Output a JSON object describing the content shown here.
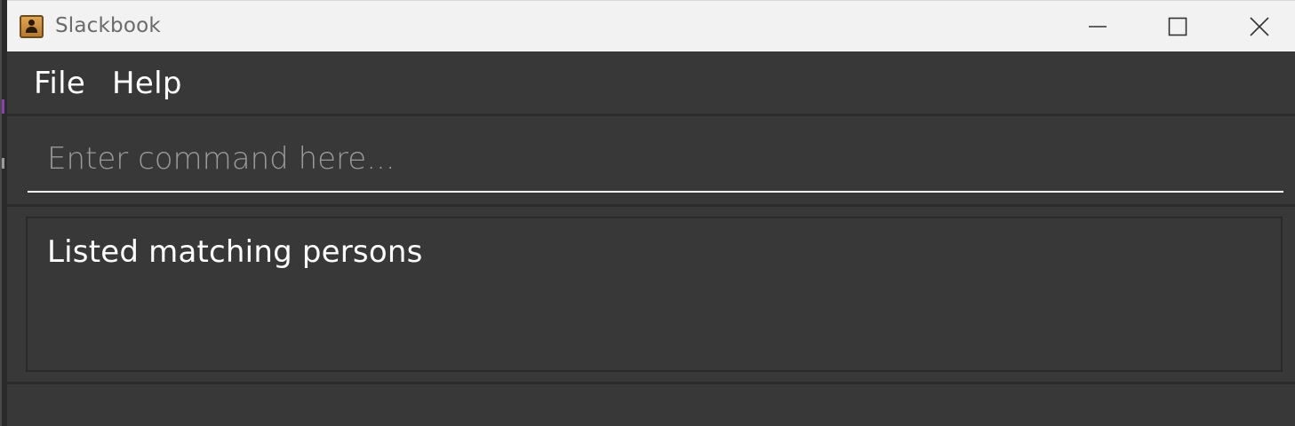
{
  "window": {
    "title": "Slackbook",
    "controls": {
      "minimize": "minimize-icon",
      "maximize": "maximize-icon",
      "close": "close-icon"
    }
  },
  "menu": {
    "items": [
      {
        "label": "File"
      },
      {
        "label": "Help"
      }
    ]
  },
  "command": {
    "placeholder": "Enter command here...",
    "value": ""
  },
  "result": {
    "message": "Listed matching persons"
  },
  "colors": {
    "titlebar_bg": "#f2f2f2",
    "app_bg": "#383838",
    "text": "#ffffff",
    "placeholder": "#9a9a9a"
  }
}
